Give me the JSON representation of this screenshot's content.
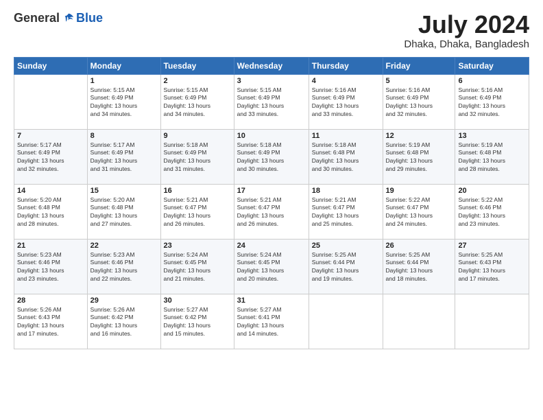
{
  "logo": {
    "general": "General",
    "blue": "Blue"
  },
  "header": {
    "month": "July 2024",
    "location": "Dhaka, Dhaka, Bangladesh"
  },
  "weekdays": [
    "Sunday",
    "Monday",
    "Tuesday",
    "Wednesday",
    "Thursday",
    "Friday",
    "Saturday"
  ],
  "weeks": [
    [
      {
        "day": "",
        "info": ""
      },
      {
        "day": "1",
        "info": "Sunrise: 5:15 AM\nSunset: 6:49 PM\nDaylight: 13 hours\nand 34 minutes."
      },
      {
        "day": "2",
        "info": "Sunrise: 5:15 AM\nSunset: 6:49 PM\nDaylight: 13 hours\nand 34 minutes."
      },
      {
        "day": "3",
        "info": "Sunrise: 5:15 AM\nSunset: 6:49 PM\nDaylight: 13 hours\nand 33 minutes."
      },
      {
        "day": "4",
        "info": "Sunrise: 5:16 AM\nSunset: 6:49 PM\nDaylight: 13 hours\nand 33 minutes."
      },
      {
        "day": "5",
        "info": "Sunrise: 5:16 AM\nSunset: 6:49 PM\nDaylight: 13 hours\nand 32 minutes."
      },
      {
        "day": "6",
        "info": "Sunrise: 5:16 AM\nSunset: 6:49 PM\nDaylight: 13 hours\nand 32 minutes."
      }
    ],
    [
      {
        "day": "7",
        "info": "Sunrise: 5:17 AM\nSunset: 6:49 PM\nDaylight: 13 hours\nand 32 minutes."
      },
      {
        "day": "8",
        "info": "Sunrise: 5:17 AM\nSunset: 6:49 PM\nDaylight: 13 hours\nand 31 minutes."
      },
      {
        "day": "9",
        "info": "Sunrise: 5:18 AM\nSunset: 6:49 PM\nDaylight: 13 hours\nand 31 minutes."
      },
      {
        "day": "10",
        "info": "Sunrise: 5:18 AM\nSunset: 6:49 PM\nDaylight: 13 hours\nand 30 minutes."
      },
      {
        "day": "11",
        "info": "Sunrise: 5:18 AM\nSunset: 6:48 PM\nDaylight: 13 hours\nand 30 minutes."
      },
      {
        "day": "12",
        "info": "Sunrise: 5:19 AM\nSunset: 6:48 PM\nDaylight: 13 hours\nand 29 minutes."
      },
      {
        "day": "13",
        "info": "Sunrise: 5:19 AM\nSunset: 6:48 PM\nDaylight: 13 hours\nand 28 minutes."
      }
    ],
    [
      {
        "day": "14",
        "info": "Sunrise: 5:20 AM\nSunset: 6:48 PM\nDaylight: 13 hours\nand 28 minutes."
      },
      {
        "day": "15",
        "info": "Sunrise: 5:20 AM\nSunset: 6:48 PM\nDaylight: 13 hours\nand 27 minutes."
      },
      {
        "day": "16",
        "info": "Sunrise: 5:21 AM\nSunset: 6:47 PM\nDaylight: 13 hours\nand 26 minutes."
      },
      {
        "day": "17",
        "info": "Sunrise: 5:21 AM\nSunset: 6:47 PM\nDaylight: 13 hours\nand 26 minutes."
      },
      {
        "day": "18",
        "info": "Sunrise: 5:21 AM\nSunset: 6:47 PM\nDaylight: 13 hours\nand 25 minutes."
      },
      {
        "day": "19",
        "info": "Sunrise: 5:22 AM\nSunset: 6:47 PM\nDaylight: 13 hours\nand 24 minutes."
      },
      {
        "day": "20",
        "info": "Sunrise: 5:22 AM\nSunset: 6:46 PM\nDaylight: 13 hours\nand 23 minutes."
      }
    ],
    [
      {
        "day": "21",
        "info": "Sunrise: 5:23 AM\nSunset: 6:46 PM\nDaylight: 13 hours\nand 23 minutes."
      },
      {
        "day": "22",
        "info": "Sunrise: 5:23 AM\nSunset: 6:46 PM\nDaylight: 13 hours\nand 22 minutes."
      },
      {
        "day": "23",
        "info": "Sunrise: 5:24 AM\nSunset: 6:45 PM\nDaylight: 13 hours\nand 21 minutes."
      },
      {
        "day": "24",
        "info": "Sunrise: 5:24 AM\nSunset: 6:45 PM\nDaylight: 13 hours\nand 20 minutes."
      },
      {
        "day": "25",
        "info": "Sunrise: 5:25 AM\nSunset: 6:44 PM\nDaylight: 13 hours\nand 19 minutes."
      },
      {
        "day": "26",
        "info": "Sunrise: 5:25 AM\nSunset: 6:44 PM\nDaylight: 13 hours\nand 18 minutes."
      },
      {
        "day": "27",
        "info": "Sunrise: 5:25 AM\nSunset: 6:43 PM\nDaylight: 13 hours\nand 17 minutes."
      }
    ],
    [
      {
        "day": "28",
        "info": "Sunrise: 5:26 AM\nSunset: 6:43 PM\nDaylight: 13 hours\nand 17 minutes."
      },
      {
        "day": "29",
        "info": "Sunrise: 5:26 AM\nSunset: 6:42 PM\nDaylight: 13 hours\nand 16 minutes."
      },
      {
        "day": "30",
        "info": "Sunrise: 5:27 AM\nSunset: 6:42 PM\nDaylight: 13 hours\nand 15 minutes."
      },
      {
        "day": "31",
        "info": "Sunrise: 5:27 AM\nSunset: 6:41 PM\nDaylight: 13 hours\nand 14 minutes."
      },
      {
        "day": "",
        "info": ""
      },
      {
        "day": "",
        "info": ""
      },
      {
        "day": "",
        "info": ""
      }
    ]
  ]
}
